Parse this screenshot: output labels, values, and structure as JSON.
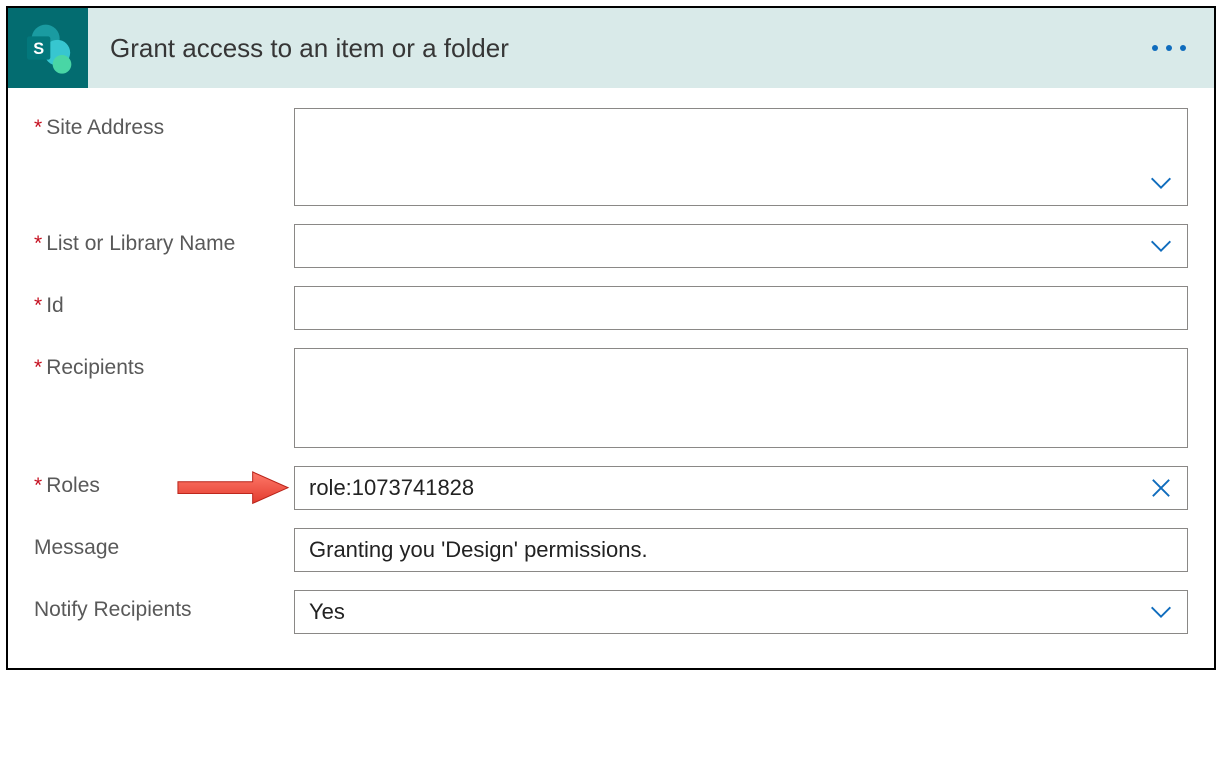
{
  "header": {
    "title": "Grant access to an item or a folder"
  },
  "fields": {
    "siteAddress": {
      "label": "Site Address",
      "required": true,
      "value": ""
    },
    "listLibrary": {
      "label": "List or Library Name",
      "required": true,
      "value": ""
    },
    "id": {
      "label": "Id",
      "required": true,
      "value": ""
    },
    "recipients": {
      "label": "Recipients",
      "required": true,
      "value": ""
    },
    "roles": {
      "label": "Roles",
      "required": true,
      "value": "role:1073741828"
    },
    "message": {
      "label": "Message",
      "required": false,
      "value": "Granting you 'Design' permissions."
    },
    "notify": {
      "label": "Notify Recipients",
      "required": false,
      "value": "Yes"
    }
  }
}
